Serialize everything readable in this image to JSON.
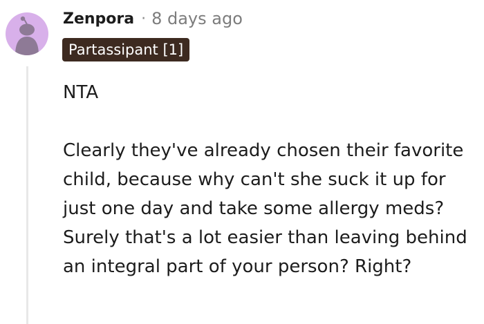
{
  "comment": {
    "author": "Zenpora",
    "separator": "·",
    "timestamp": "8 days ago",
    "flair": "Partassipant [1]",
    "paragraphs": [
      "NTA",
      "Clearly they've already chosen their favorite child, because why can't she suck it up for just one day and take some allergy meds? Surely that's a lot easier than leaving behind an integral part of your person? Right?"
    ]
  },
  "colors": {
    "avatar_background": "#d8b0ea",
    "avatar_figure": "#8e7a96",
    "flair_background": "#3d2a20",
    "flair_text": "#ffffff",
    "thread_line": "#e8e8e8",
    "username": "#1c1c1c",
    "timestamp": "#7c7c7c",
    "body_text": "#1c1c1c"
  },
  "icons": {
    "avatar": "snoo-avatar-icon"
  }
}
